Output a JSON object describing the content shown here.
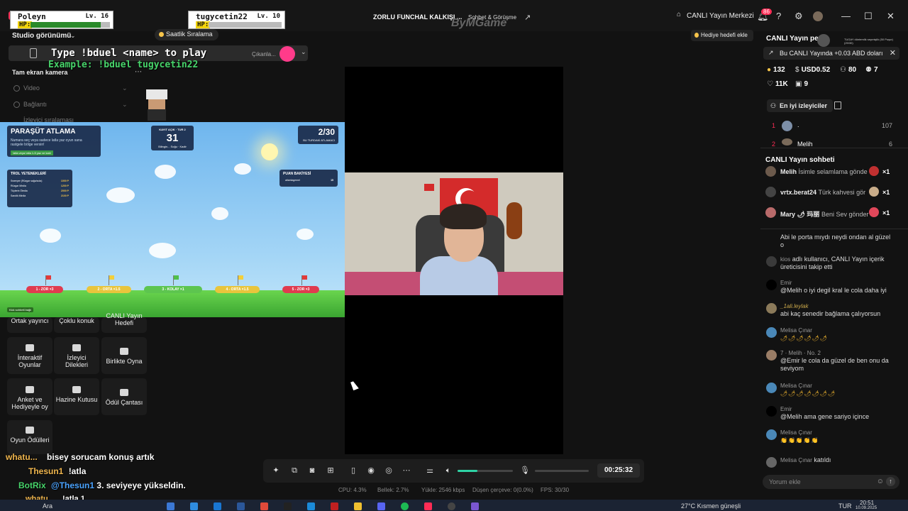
{
  "topbar": {
    "player1": {
      "name": "Poleyn",
      "level": "Lv. 16",
      "hp_label": "HP:",
      "hp": 0.88
    },
    "player2": {
      "name": "tugycetin22",
      "level": "Lv. 10",
      "hp_label": "HP:",
      "hp": 0.0
    },
    "stream_title": "ZORLU FUNCHAL KALKIŞI ...",
    "chat_tab": "Sohbet & Görüşme",
    "watermark": "ByMGame",
    "live_center": "CANLI Yayın Merkezi",
    "notif_count": "86"
  },
  "studio": {
    "view_label": "Studio görünümü",
    "hourly_ranking": "Saatlik Sıralama",
    "game_instruction": "Type !bduel <name> to play",
    "game_example": "Example: !bduel tugycetin22",
    "cikan_label": "Çıkanla...",
    "fullscreen_cam": "Tam ekran kamera",
    "sources": [
      "Video",
      "Bağlantı",
      "İzleyici sıralaması"
    ],
    "tools": [
      {
        "label": "Ortak yayıncı",
        "icon": "cohost-icon"
      },
      {
        "label": "Çoklu konuk",
        "icon": "multi-guest-icon"
      },
      {
        "label": "CANLI Yayın Hedefi",
        "icon": "goal-icon"
      },
      {
        "label": "İnteraktif Oyunlar",
        "icon": "gamepad-icon"
      },
      {
        "label": "İzleyici Dilekleri",
        "icon": "gift-icon"
      },
      {
        "label": "Birlikte Oyna",
        "icon": "play-together-icon"
      },
      {
        "label": "Anket ve Hediyeyle oy",
        "icon": "poll-icon"
      },
      {
        "label": "Hazine Kutusu",
        "icon": "treasure-icon"
      },
      {
        "label": "Ödül Çantası",
        "icon": "bag-icon"
      },
      {
        "label": "Oyun Ödülleri",
        "icon": "game-reward-icon"
      }
    ]
  },
  "game": {
    "title": "PARAŞÜT ATLAMA",
    "subtitle": "Numara seç veya sadece latla yaz oyun sana rastgele bölge versin!",
    "hint_btn": "!atla veya !atla 1-5 yaz ve katıl",
    "round_title": "KAYIT AÇIK · TUR 2",
    "round_value": "31",
    "round_sub": "Bilingin... Soğu · Kadir",
    "count_value": "2/30",
    "count_sub": "BU TURDAKİ ATLAMACI",
    "troll_title": "TROL YETENEKLERİ",
    "troll_items": [
      "Sweeper (Rüzgar sağa/sola)",
      "Rüzgar Mirdia",
      "Tüylerin Ötedia",
      "Sandik Mirdia"
    ],
    "troll_costs": [
      "1000 P",
      "1200 P",
      "2000 P",
      "2100 P"
    ],
    "points_title": "PUAN BAKİYESİ",
    "points_user": "atlamlagemel",
    "points_value": "15",
    "lanes": [
      "1 - ZOR ×3",
      "2 - ORTA ×1.5",
      "3 - KOLAY ×1",
      "4 - ORTA ×1.5",
      "5 - ZOR ×3"
    ],
    "kick_label": "Kick sohbeti bağlı"
  },
  "controls": {
    "timer": "00:25:32",
    "volume": 0.36,
    "stats": {
      "cpu": "CPU: 4.3%",
      "memory": "Bellek: 2.7%",
      "upload": "Yükle: 2546 kbps",
      "dropped": "Düşen çerçeve: 0(0.0%)",
      "fps": "FPS: 30/30"
    }
  },
  "right": {
    "title": "CANLI Yayın pe...",
    "cohost_text": "TUGAY döntemlik sepmişlik (50 Puşur) (29/30)",
    "gift_target": "Hediye hedefi ekle",
    "notice": "Bu CANLI Yayında +0.03 ABD doları",
    "metrics": [
      {
        "icon": "coin-icon",
        "value": "132"
      },
      {
        "icon": "dollar-icon",
        "value": "USD0.52"
      },
      {
        "icon": "users-icon",
        "value": "80"
      },
      {
        "icon": "user-add-icon",
        "value": "7"
      },
      {
        "icon": "heart-icon",
        "value": "11K"
      },
      {
        "icon": "gift-box-icon",
        "value": "9"
      }
    ],
    "best_viewers": "En iyi izleyiciler",
    "ranks": [
      {
        "rank": "1",
        "name": ".",
        "score": "107"
      },
      {
        "rank": "2",
        "name": "Melih",
        "score": "6"
      }
    ],
    "chat_title": "CANLI Yayın sohbeti",
    "gift_rows": [
      {
        "name": "Melih",
        "text": "İsimle selamlama gönde",
        "count": "×1"
      },
      {
        "name": "vrtx.berat24",
        "text": "Türk kahvesi gör",
        "count": "×1"
      },
      {
        "name": "Mary 🌶 玛丽",
        "text": "Beni Sev gönder",
        "count": "×1"
      }
    ],
    "messages": [
      {
        "name": "",
        "text": "Abi le porta mıydı neydi ondan al güzel o"
      },
      {
        "name": "kios",
        "text": "adlı kullanıcı, CANLI Yayın içerik üreticisini takip etti"
      },
      {
        "name": "Emir",
        "text": "@Melih o iyi degil kral le cola daha iyi"
      },
      {
        "name": "_1ali.leylak",
        "text": "abi kaç senedir bağlama çalıyorsun"
      },
      {
        "name": "Melisa Çınar",
        "text": "🌶🌶🌶🌶🌶🌶"
      },
      {
        "name": "7 · Melih · No. 2",
        "text": "@Emir le cola da güzel de ben onu da seviyom"
      },
      {
        "name": "Melisa Çınar",
        "text": "🌶🌶🌶🌶🌶🌶🌶"
      },
      {
        "name": "Emir",
        "text": "@Melih ama gene sariyo içince"
      },
      {
        "name": "Melisa Çınar",
        "text": "👏👏👏👏👏"
      },
      {
        "name": "Melisa Çınar",
        "text": "katıldı"
      }
    ],
    "comment_placeholder": "Yorum ekle"
  },
  "overlay_chat": [
    {
      "name": "whatu...",
      "text": "bisey sorucam konuş artık"
    },
    {
      "name": "Thesun1",
      "text": "!atla"
    },
    {
      "name": "BotRix",
      "mention": "@Thesun1",
      "text": "3. seviyeye yükseldin."
    },
    {
      "name": "whatu...",
      "text": "!atla 1"
    }
  ],
  "taskbar": {
    "search": "Ara",
    "weather": "27°C  Kısmen güneşli",
    "lang": "TUR",
    "time": "20:51",
    "date": "10.09.2025"
  },
  "colors": {
    "accent": "#fe2c55",
    "teal": "#2ed3a5",
    "gold": "#f6c44a"
  }
}
